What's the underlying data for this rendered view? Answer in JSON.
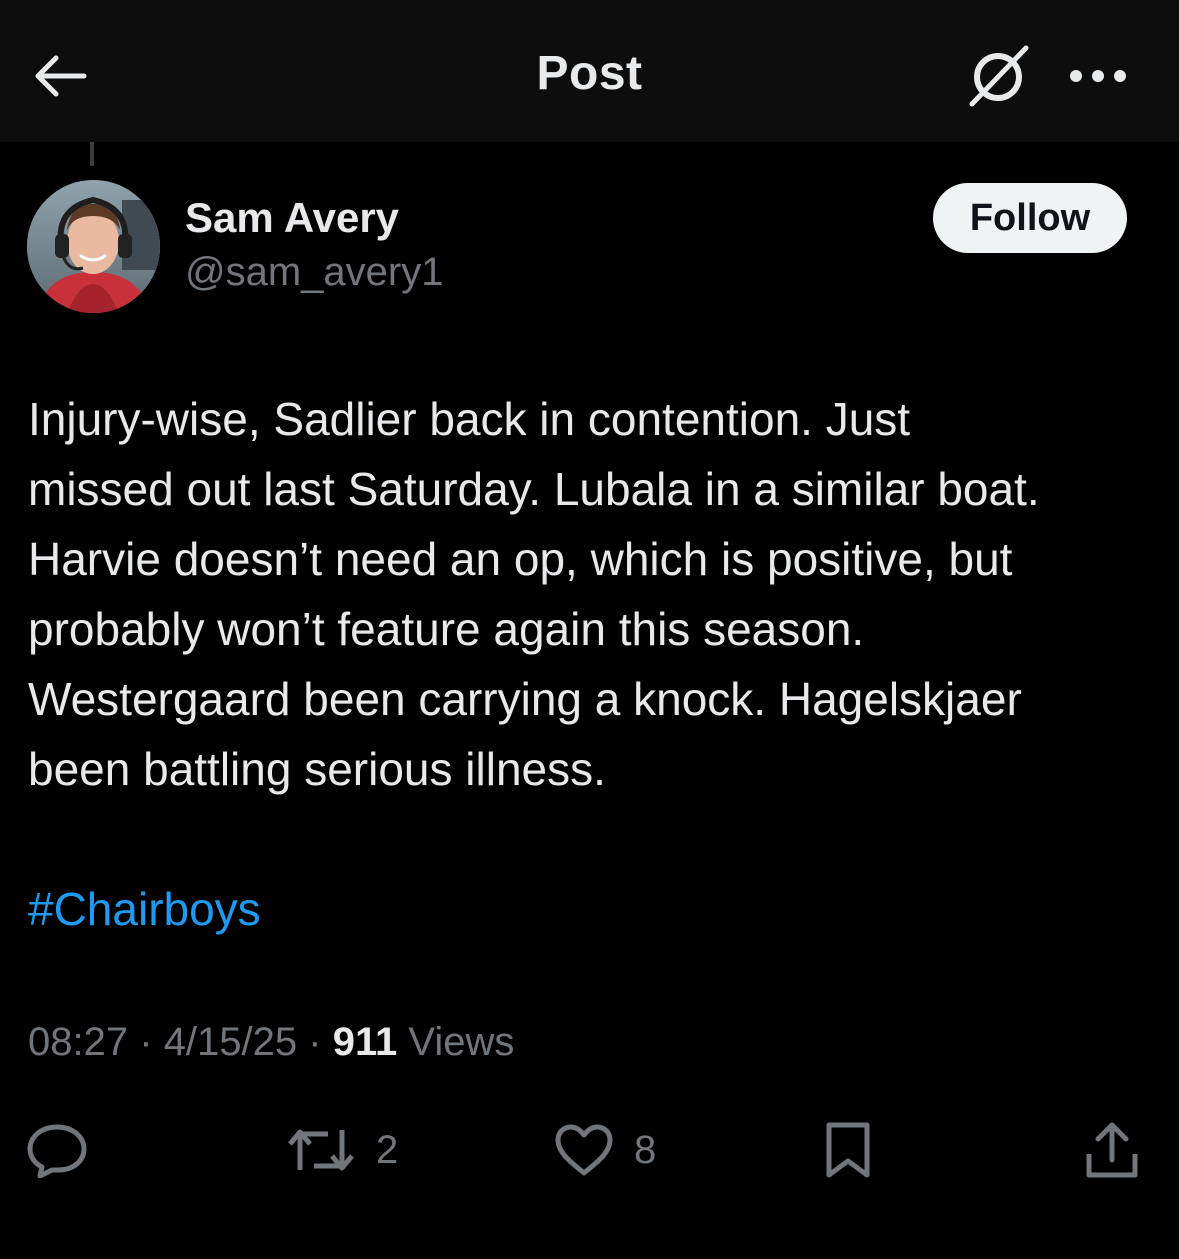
{
  "header": {
    "title": "Post"
  },
  "author": {
    "display_name": "Sam Avery",
    "handle": "@sam_avery1",
    "follow_label": "Follow"
  },
  "post": {
    "text": "Injury-wise, Sadlier back in contention. Just\nmissed out last Saturday. Lubala in a similar boat.\nHarvie doesn’t need an op, which is positive, but\nprobably won’t feature again this season.\nWestergaard been carrying a knock. Hagelskjaer\nbeen battling serious illness.",
    "hashtag": "#Chairboys",
    "time": "08:27",
    "separator": "·",
    "date": "4/15/25",
    "views_count": "911",
    "views_label": "Views"
  },
  "actions": {
    "reply_count": "",
    "repost_count": "2",
    "like_count": "8"
  },
  "icons": {
    "back": "back-arrow-icon",
    "grok": "grok-icon",
    "more": "more-icon",
    "reply": "reply-icon",
    "repost": "repost-icon",
    "like": "heart-icon",
    "bookmark": "bookmark-icon",
    "share": "share-icon"
  },
  "colors": {
    "background": "#000000",
    "text": "#e7e9ea",
    "muted": "#71767b",
    "link": "#1d9bf0",
    "follow_bg": "#eff3f4"
  }
}
